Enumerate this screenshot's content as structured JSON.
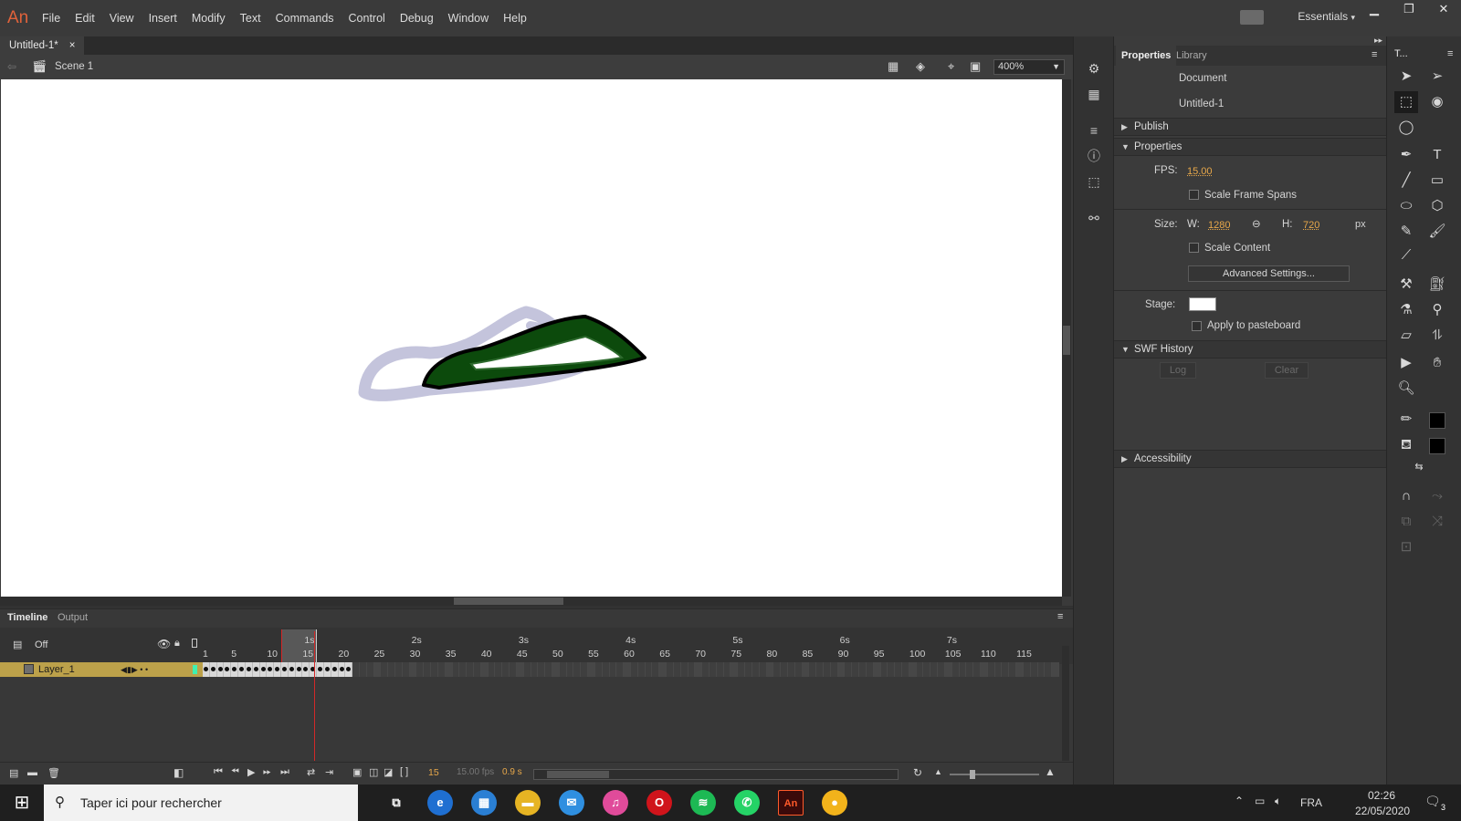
{
  "app": {
    "logo": "An",
    "workspace": "Essentials"
  },
  "menu": [
    "File",
    "Edit",
    "View",
    "Insert",
    "Modify",
    "Text",
    "Commands",
    "Control",
    "Debug",
    "Window",
    "Help"
  ],
  "window_controls": {
    "minimize": "▁",
    "restore": "❐",
    "close": "✕"
  },
  "document": {
    "tab_title": "Untitled-1*",
    "tab_close": "×",
    "scene": "Scene 1",
    "zoom": "400%"
  },
  "timeline": {
    "tabs": [
      "Timeline",
      "Output"
    ],
    "onion_label": "Off",
    "layer_name": "Layer_1",
    "seconds": [
      "1s",
      "2s",
      "3s",
      "4s",
      "5s",
      "6s",
      "7s"
    ],
    "frame_numbers": [
      "1",
      "5",
      "10",
      "15",
      "20",
      "25",
      "30",
      "35",
      "40",
      "45",
      "50",
      "55",
      "60",
      "65",
      "70",
      "75",
      "80",
      "85",
      "90",
      "95",
      "100",
      "105",
      "110",
      "115"
    ],
    "current_frame": "15",
    "fps_display": "15.00 fps",
    "time_display": "0.9 s",
    "filled_frames": 21
  },
  "properties": {
    "tabs": [
      "Properties",
      "Library"
    ],
    "doc_type": "Document",
    "doc_name": "Untitled-1",
    "doc_badge": "An",
    "publish": "Publish",
    "section": "Properties",
    "fps_label": "FPS:",
    "fps_value": "15.00",
    "scale_frame_spans": "Scale Frame Spans",
    "size_label": "Size:",
    "w_label": "W:",
    "w_value": "1280",
    "h_label": "H:",
    "h_value": "720",
    "unit": "px",
    "scale_content": "Scale Content",
    "advanced": "Advanced Settings...",
    "stage_label": "Stage:",
    "stage_color": "#ffffff",
    "apply_pasteboard": "Apply to pasteboard",
    "swf_history": "SWF History",
    "log": "Log",
    "clear": "Clear",
    "accessibility": "Accessibility"
  },
  "tools_title": "T...",
  "taskbar": {
    "search_placeholder": "Taper ici pour rechercher",
    "language": "FRA",
    "time": "02:26",
    "date": "22/05/2020",
    "notifications": "3",
    "apps": [
      {
        "name": "task-view-icon",
        "glyph": "⧉",
        "color": "#1f1f1f"
      },
      {
        "name": "edge-icon",
        "glyph": "e",
        "color": "#1f6fd1"
      },
      {
        "name": "store-icon",
        "glyph": "▦",
        "color": "#2a7fd4"
      },
      {
        "name": "file-explorer-icon",
        "glyph": "▬",
        "color": "#e6b423"
      },
      {
        "name": "mail-icon",
        "glyph": "✉",
        "color": "#2f8fe0"
      },
      {
        "name": "itunes-icon",
        "glyph": "♫",
        "color": "#e04b9a"
      },
      {
        "name": "opera-icon",
        "glyph": "O",
        "color": "#d0141b"
      },
      {
        "name": "spotify-icon",
        "glyph": "≋",
        "color": "#1db954"
      },
      {
        "name": "whatsapp-icon",
        "glyph": "✆",
        "color": "#25d366"
      },
      {
        "name": "animate-icon",
        "glyph": "An",
        "color": "#3a0a0a"
      },
      {
        "name": "chrome-icon",
        "glyph": "●",
        "color": "#f2b31b"
      }
    ]
  },
  "colors": {
    "onion_fill": "#c4c4dc",
    "shape_fill": "#0c4a0c",
    "shape_stroke": "#000000",
    "playhead": "#d22828",
    "layer_highlight": "#bca14a",
    "accent_orange": "#e8a84a"
  }
}
